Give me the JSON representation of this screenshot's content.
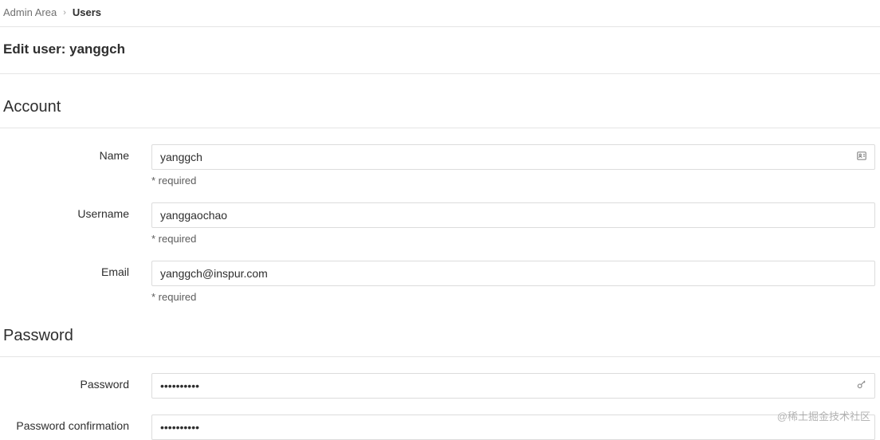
{
  "breadcrumb": {
    "root": "Admin Area",
    "current": "Users"
  },
  "page_title": "Edit user: yanggch",
  "sections": {
    "account": {
      "title": "Account",
      "fields": {
        "name": {
          "label": "Name",
          "value": "yanggch",
          "help": "* required"
        },
        "username": {
          "label": "Username",
          "value": "yanggaochao",
          "help": "* required"
        },
        "email": {
          "label": "Email",
          "value": "yanggch@inspur.com",
          "help": "* required"
        }
      }
    },
    "password": {
      "title": "Password",
      "fields": {
        "password": {
          "label": "Password",
          "value": "••••••••••"
        },
        "password_confirmation": {
          "label": "Password confirmation",
          "value": "••••••••••"
        }
      }
    }
  },
  "watermark": "@稀土掘金技术社区"
}
